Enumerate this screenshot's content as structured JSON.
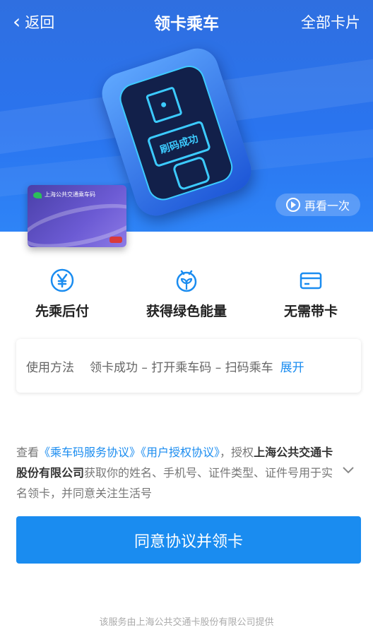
{
  "header": {
    "back_label": "返回",
    "title": "领卡乘车",
    "all_cards_label": "全部卡片"
  },
  "hero": {
    "device_text": "刷码成功",
    "replay_label": "再看一次",
    "card_name": "上海公共交通乘车码"
  },
  "features": [
    {
      "icon": "yen-icon",
      "label": "先乘后付"
    },
    {
      "icon": "sprout-icon",
      "label": "获得绿色能量"
    },
    {
      "icon": "card-icon",
      "label": "无需带卡"
    }
  ],
  "howto": {
    "label": "使用方法",
    "steps": "领卡成功 – 打开乘车码 – 扫码乘车",
    "expand_label": "展开"
  },
  "agreement": {
    "prefix": "查看",
    "link_service": "《乘车码服务协议》",
    "link_auth": "《用户授权协议》",
    "mid": "，授权",
    "company": "上海公共交通卡股份有限公司",
    "suffix": "获取你的姓名、手机号、证件类型、证件号用于实名领卡，并同意关注生活号"
  },
  "primary_button": "同意协议并领卡",
  "footer": "该服务由上海公共交通卡股份有限公司提供",
  "colors": {
    "accent": "#1a8cf0",
    "hero": "#2a74ef"
  }
}
